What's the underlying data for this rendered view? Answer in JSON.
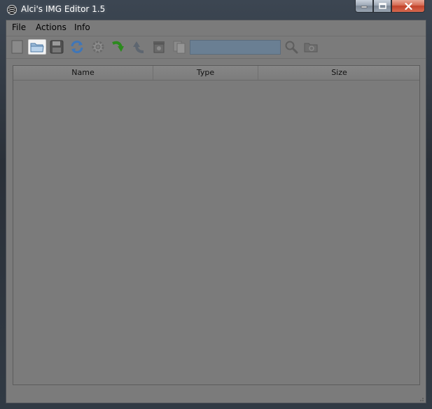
{
  "window": {
    "title": "Alci's IMG Editor 1.5"
  },
  "menu": {
    "items": [
      "File",
      "Actions",
      "Info"
    ]
  },
  "toolbar": {
    "icons": [
      "new-file-icon",
      "open-folder-icon",
      "save-icon",
      "refresh-icon",
      "settings-icon",
      "import-icon",
      "export-icon",
      "delete-icon",
      "copy-icon",
      "search-icon",
      "find-folder-icon"
    ],
    "search": {
      "value": "",
      "placeholder": ""
    }
  },
  "table": {
    "columns": [
      "Name",
      "Type",
      "Size"
    ],
    "rows": []
  },
  "colors": {
    "client_bg": "#7b7b7b",
    "search_bg": "#6a7f93",
    "title_text": "#ffffff"
  }
}
